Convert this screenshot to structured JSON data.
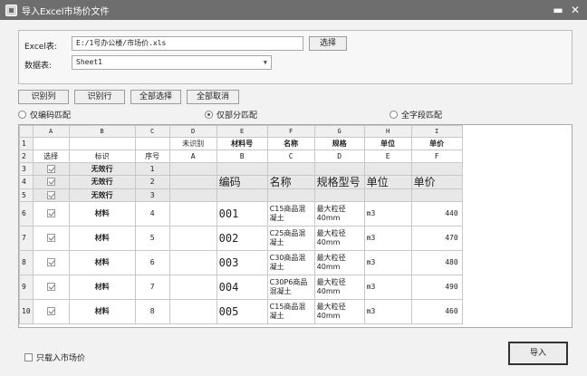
{
  "window": {
    "title": "导入Excel市场价文件",
    "minimize": "▬",
    "close": "✕"
  },
  "form": {
    "excel_label": "Excel表:",
    "excel_path": "E:/1号办公楼/市场价.xls",
    "browse_label": "选择",
    "sheet_label": "数据表:",
    "sheet_value": "Sheet1"
  },
  "toolbar": {
    "identify_col": "识别列",
    "identify_row": "识别行",
    "select_all": "全部选择",
    "cancel_all": "全部取消"
  },
  "match": {
    "options": [
      {
        "label": "仅编码匹配",
        "checked": false
      },
      {
        "label": "仅部分匹配",
        "checked": true
      },
      {
        "label": "全字段匹配",
        "checked": false
      }
    ]
  },
  "grid": {
    "col_letters": [
      "",
      "A",
      "B",
      "C",
      "D",
      "E",
      "F",
      "G",
      "H",
      "I"
    ],
    "row1": [
      "1",
      "",
      "",
      "",
      "未识别",
      "材料号",
      "名称",
      "规格",
      "单位",
      "单价"
    ],
    "row2": [
      "2",
      "选择",
      "标识",
      "序号",
      "A",
      "B",
      "C",
      "D",
      "E",
      "F"
    ],
    "invalid_rows": [
      {
        "num": "3",
        "tag": "无效行",
        "seq": "1"
      },
      {
        "num": "4",
        "tag": "无效行",
        "seq": "2",
        "code": "编码",
        "name": "名称",
        "spec": "规格型号",
        "unit": "单位",
        "price": "单价"
      },
      {
        "num": "5",
        "tag": "无效行",
        "seq": "3"
      }
    ],
    "material_rows": [
      {
        "num": "6",
        "tag": "材料",
        "seq": "4",
        "code": "001",
        "name": "C15商品混凝土",
        "spec": "最大粒径40mm",
        "unit": "m3",
        "price": "440"
      },
      {
        "num": "7",
        "tag": "材料",
        "seq": "5",
        "code": "002",
        "name": "C25商品混凝土",
        "spec": "最大粒径40mm",
        "unit": "m3",
        "price": "470"
      },
      {
        "num": "8",
        "tag": "材料",
        "seq": "6",
        "code": "003",
        "name": "C30商品混凝土",
        "spec": "最大粒径40mm",
        "unit": "m3",
        "price": "480"
      },
      {
        "num": "9",
        "tag": "材料",
        "seq": "7",
        "code": "004",
        "name": "C30P6商品混凝土",
        "spec": "最大粒径40mm",
        "unit": "m3",
        "price": "490"
      },
      {
        "num": "10",
        "tag": "材料",
        "seq": "8",
        "code": "005",
        "name": "C15商品混凝土",
        "spec": "最大粒径40mm",
        "unit": "m3",
        "price": "460"
      }
    ]
  },
  "footer": {
    "only_market_price": "只载入市场价",
    "import_label": "导入"
  }
}
